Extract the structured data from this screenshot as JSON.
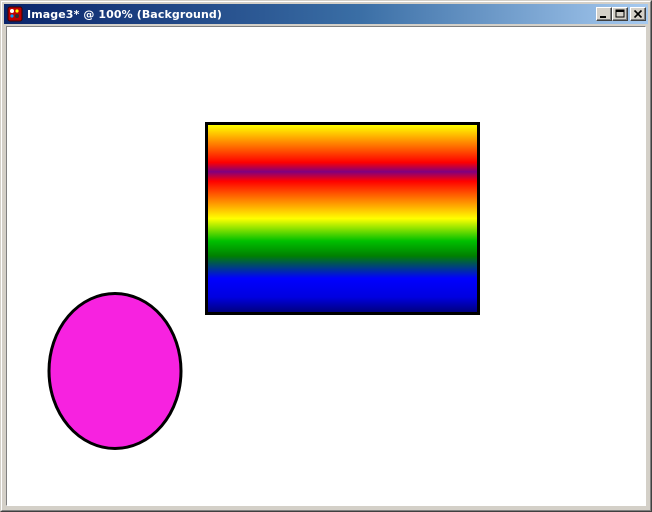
{
  "window": {
    "title": "Image3* @ 100% (Background)",
    "title_bar_color": "#0a246a",
    "buttons": {
      "minimize_icon": "minimize-icon",
      "maximize_icon": "maximize-icon",
      "close_icon": "close-icon"
    },
    "app_icon": "paint-palette-icon"
  },
  "canvas": {
    "background": "#ffffff",
    "shapes": [
      {
        "type": "rectangle",
        "fill": "rainbow-vertical-gradient",
        "gradient_colors": [
          "#ffff00",
          "#ff8000",
          "#ff0000",
          "#800080",
          "#ff0000",
          "#ff8000",
          "#ffff00",
          "#00c000",
          "#008000",
          "#0000ff",
          "#000080"
        ],
        "stroke": "#000000"
      },
      {
        "type": "ellipse",
        "fill": "#f722e0",
        "stroke": "#000000"
      }
    ]
  }
}
